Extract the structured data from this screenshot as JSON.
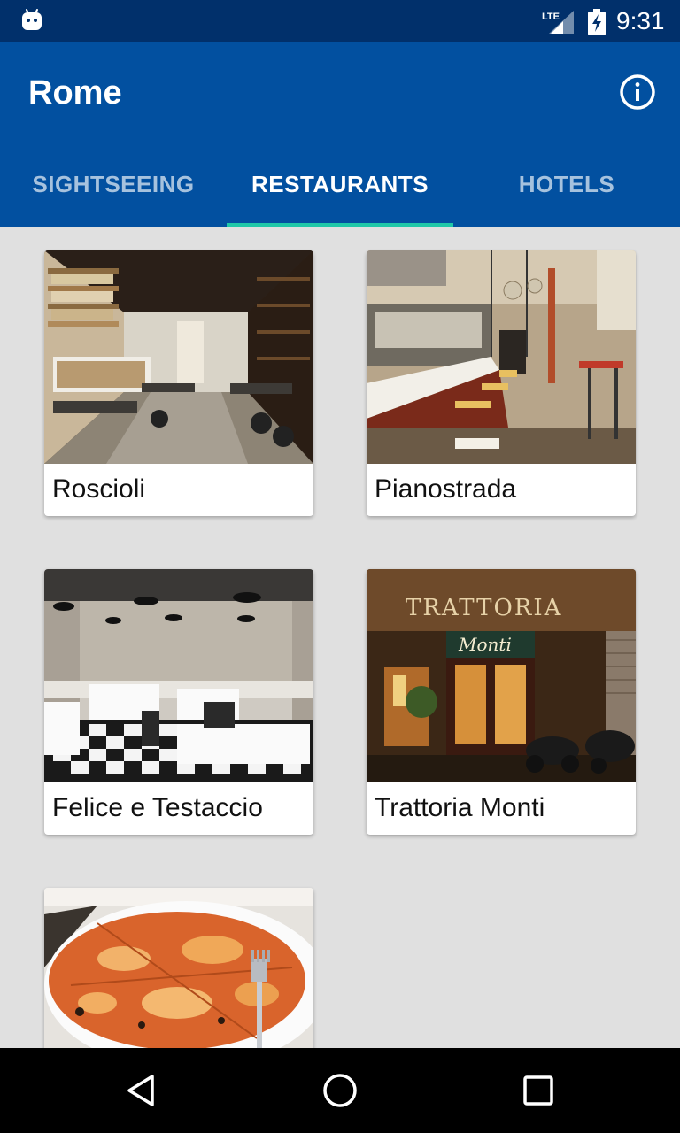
{
  "status_bar": {
    "time": "9:31",
    "network": "LTE"
  },
  "app_bar": {
    "title": "Rome"
  },
  "tabs": [
    {
      "label": "SIGHTSEEING",
      "active": false
    },
    {
      "label": "RESTAURANTS",
      "active": true
    },
    {
      "label": "HOTELS",
      "active": false
    }
  ],
  "restaurants": [
    {
      "name": "Roscioli",
      "image": "deli-interior-photo"
    },
    {
      "name": "Pianostrada",
      "image": "bar-counter-photo"
    },
    {
      "name": "Felice e Testaccio",
      "image": "dining-room-photo"
    },
    {
      "name": "Trattoria Monti",
      "image": "storefront-night-photo"
    },
    {
      "name": "",
      "image": "pizza-photo"
    }
  ],
  "colors": {
    "status_bar": "#01306b",
    "app_bar": "#0250a0",
    "tab_indicator": "#1fc8a8",
    "background": "#e0e0e0"
  },
  "icons": [
    "android-icon",
    "lte-signal-icon",
    "battery-charging-icon",
    "info-icon",
    "back-icon",
    "home-icon",
    "recents-icon"
  ]
}
